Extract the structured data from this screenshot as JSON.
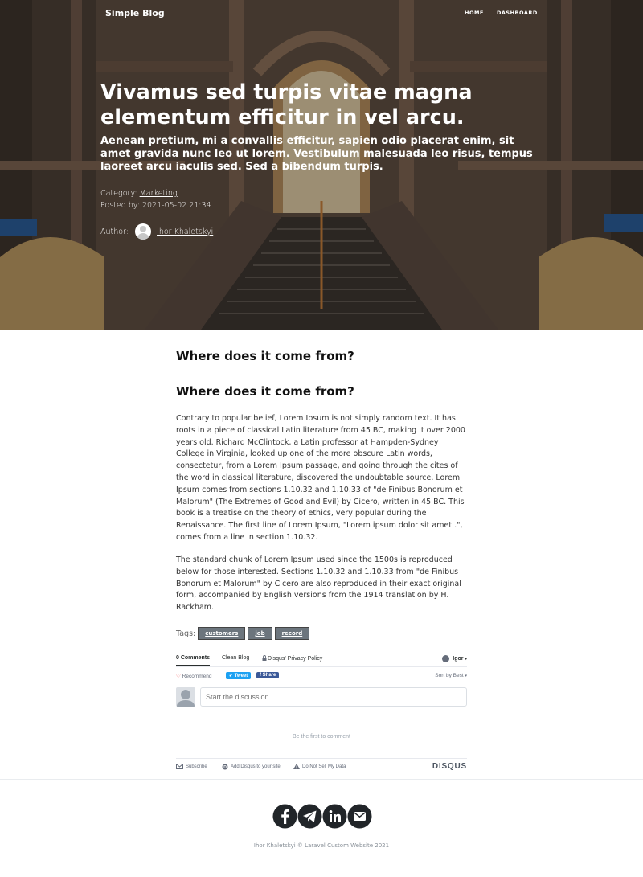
{
  "nav": {
    "brand": "Simple Blog",
    "links": [
      "HOME",
      "DASHBOARD"
    ]
  },
  "post": {
    "title": "Vivamus sed turpis vitae magna elementum efficitur in vel arcu.",
    "subtitle": "Aenean pretium, mi a convallis efficitur, sapien odio placerat enim, sit amet gravida nunc leo ut lorem. Vestibulum malesuada leo risus, tempus laoreet arcu iaculis sed. Sed a bibendum turpis.",
    "category_label": "Category:",
    "category": "Marketing",
    "posted_label": "Posted by:",
    "posted_at": "2021-05-02 21:34",
    "author_label": "Author:",
    "author": "Ihor Khaletskyi"
  },
  "article": {
    "heading_1": "Where does it come from?",
    "heading_2": "Where does it come from?",
    "paragraph_1": "Contrary to popular belief, Lorem Ipsum is not simply random text. It has roots in a piece of classical Latin literature from 45 BC, making it over 2000 years old. Richard McClintock, a Latin professor at Hampden-Sydney College in Virginia, looked up one of the more obscure Latin words, consectetur, from a Lorem Ipsum passage, and going through the cites of the word in classical literature, discovered the undoubtable source. Lorem Ipsum comes from sections 1.10.32 and 1.10.33 of \"de Finibus Bonorum et Malorum\" (The Extremes of Good and Evil) by Cicero, written in 45 BC. This book is a treatise on the theory of ethics, very popular during the Renaissance. The first line of Lorem Ipsum, \"Lorem ipsum dolor sit amet..\", comes from a line in section 1.10.32.",
    "paragraph_2": "The standard chunk of Lorem Ipsum used since the 1500s is reproduced below for those interested. Sections 1.10.32 and 1.10.33 from \"de Finibus Bonorum et Malorum\" by Cicero are also reproduced in their exact original form, accompanied by English versions from the 1914 translation by H. Rackham.",
    "tags_label": "Tags:",
    "tags": [
      "customers",
      "job",
      "record"
    ]
  },
  "disqus": {
    "tabs": [
      "0 Comments",
      "Clean Blog",
      "Disqus' Privacy Policy"
    ],
    "user": "Igor",
    "recommend": "Recommend",
    "tweet": "Tweet",
    "share": "Share",
    "sort": "Sort by Best",
    "placeholder": "Start the discussion...",
    "first_comment": "Be the first to comment",
    "footer": [
      "Subscribe",
      "Add Disqus to your site",
      "Do Not Sell My Data"
    ],
    "logo": "DISQUS"
  },
  "footer": {
    "social_icons": [
      "facebook-icon",
      "telegram-icon",
      "linkedin-icon",
      "mail-icon"
    ],
    "copyright": "Ihor Khaletskyi © Laravel Custom Website 2021"
  },
  "colors": {
    "tag_bg": "#6c757d",
    "tweet_blue": "#1da1f2",
    "share_blue": "#3b5998",
    "icon_dark": "#212529"
  }
}
